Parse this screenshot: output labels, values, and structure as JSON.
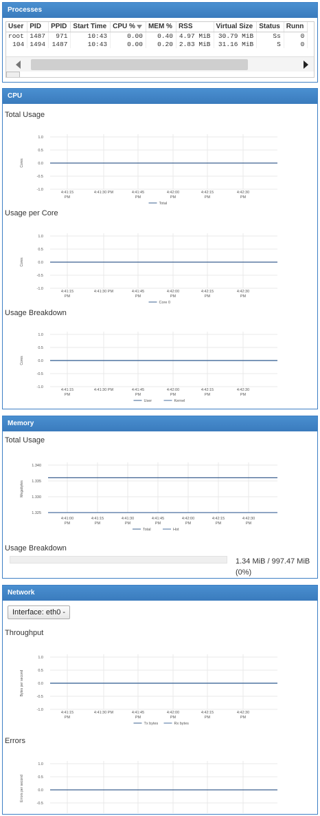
{
  "processes": {
    "title": "Processes",
    "columns": [
      "User",
      "PID",
      "PPID",
      "Start Time",
      "CPU %",
      "MEM %",
      "RSS",
      "Virtual Size",
      "Status",
      "Runn"
    ],
    "rows": [
      [
        "root",
        "1487",
        "971",
        "10:43",
        "0.00",
        "0.40",
        "4.97 MiB",
        "30.79 MiB",
        "Ss",
        "0"
      ],
      [
        "104",
        "1494",
        "1487",
        "10:43",
        "0.00",
        "0.20",
        "2.83 MiB",
        "31.16 MiB",
        "S",
        "0"
      ]
    ]
  },
  "cpu": {
    "title": "CPU",
    "total_usage": {
      "title": "Total Usage",
      "chart_data": {
        "type": "line",
        "x": [
          "4:41:15 PM",
          "4:41:30 PM",
          "4:41:45 PM",
          "4:42:00 PM",
          "4:42:15 PM",
          "4:42:30 PM"
        ],
        "xtick_lines": [
          [
            "4:41:15",
            "PM"
          ],
          [
            "4:41:30 PM"
          ],
          [
            "4:41:45",
            "PM"
          ],
          [
            "4:42:00",
            "PM"
          ],
          [
            "4:42:15",
            "PM"
          ],
          [
            "4:42:30",
            "PM"
          ]
        ],
        "yticks": [
          "1.0",
          "0.5",
          "0.0",
          "-0.5",
          "-1.0"
        ],
        "ylim": [
          -1.0,
          1.0
        ],
        "ylabel": "Cores",
        "series": [
          {
            "name": "Total",
            "values": [
              0,
              0,
              0,
              0,
              0,
              0
            ],
            "color": "#3a5f8f"
          }
        ]
      }
    },
    "usage_per_core": {
      "title": "Usage per Core",
      "chart_data": {
        "type": "line",
        "x": [
          "4:41:15 PM",
          "4:41:30 PM",
          "4:41:45 PM",
          "4:42:00 PM",
          "4:42:15 PM",
          "4:42:30 PM"
        ],
        "xtick_lines": [
          [
            "4:41:15",
            "PM"
          ],
          [
            "4:41:30 PM"
          ],
          [
            "4:41:45",
            "PM"
          ],
          [
            "4:42:00",
            "PM"
          ],
          [
            "4:42:15",
            "PM"
          ],
          [
            "4:42:30",
            "PM"
          ]
        ],
        "yticks": [
          "1.0",
          "0.5",
          "0.0",
          "-0.5",
          "-1.0"
        ],
        "ylim": [
          -1.0,
          1.0
        ],
        "ylabel": "Cores",
        "series": [
          {
            "name": "Core 0",
            "values": [
              0,
              0,
              0,
              0,
              0,
              0
            ],
            "color": "#3a5f8f"
          }
        ]
      }
    },
    "usage_breakdown": {
      "title": "Usage Breakdown",
      "chart_data": {
        "type": "line",
        "x": [
          "4:41:15 PM",
          "4:41:30 PM",
          "4:41:45 PM",
          "4:42:00 PM",
          "4:42:15 PM",
          "4:42:30 PM"
        ],
        "xtick_lines": [
          [
            "4:41:15",
            "PM"
          ],
          [
            "4:41:30 PM"
          ],
          [
            "4:41:45",
            "PM"
          ],
          [
            "4:42:00",
            "PM"
          ],
          [
            "4:42:15",
            "PM"
          ],
          [
            "4:42:30",
            "PM"
          ]
        ],
        "yticks": [
          "1.0",
          "0.5",
          "0.0",
          "-0.5",
          "-1.0"
        ],
        "ylim": [
          -1.0,
          1.0
        ],
        "ylabel": "Cores",
        "series": [
          {
            "name": "User",
            "values": [
              0,
              0,
              0,
              0,
              0,
              0
            ],
            "color": "#3a5f8f"
          },
          {
            "name": "Kernel",
            "values": [
              0,
              0,
              0,
              0,
              0,
              0
            ],
            "color": "#4a6f9f"
          }
        ]
      }
    }
  },
  "memory": {
    "title": "Memory",
    "total_usage": {
      "title": "Total Usage",
      "chart_data": {
        "type": "line",
        "x": [
          "4:41:00 PM",
          "4:41:15 PM",
          "4:41:30 PM",
          "4:41:45 PM",
          "4:42:00 PM",
          "4:42:15 PM",
          "4:42:30 PM"
        ],
        "xtick_lines": [
          [
            "4:41:00",
            "PM"
          ],
          [
            "4:41:15",
            "PM"
          ],
          [
            "4:41:30",
            "PM"
          ],
          [
            "4:41:45",
            "PM"
          ],
          [
            "4:42:00",
            "PM"
          ],
          [
            "4:42:15",
            "PM"
          ],
          [
            "4:42:30",
            "PM"
          ]
        ],
        "yticks": [
          "1.340",
          "1.335",
          "1.330",
          "1.325"
        ],
        "ylim": [
          1.325,
          1.34
        ],
        "ylabel": "Megabytes",
        "series": [
          {
            "name": "Total",
            "values": [
              1.336,
              1.336,
              1.336,
              1.336,
              1.336,
              1.336,
              1.336
            ],
            "color": "#3a5f8f"
          },
          {
            "name": "Hot",
            "values": [
              1.325,
              1.325,
              1.325,
              1.325,
              1.325,
              1.325,
              1.325
            ],
            "color": "#4a6f9f"
          }
        ]
      }
    },
    "usage_breakdown": {
      "title": "Usage Breakdown",
      "used_fraction": 0.0,
      "text": "1.34 MiB / 997.47 MiB (0%)"
    }
  },
  "network": {
    "title": "Network",
    "interface_label": "Interface: eth0 -",
    "throughput": {
      "title": "Throughput",
      "chart_data": {
        "type": "line",
        "x": [
          "4:41:15 PM",
          "4:41:30 PM",
          "4:41:45 PM",
          "4:42:00 PM",
          "4:42:15 PM",
          "4:42:30 PM"
        ],
        "xtick_lines": [
          [
            "4:41:15",
            "PM"
          ],
          [
            "4:41:30 PM"
          ],
          [
            "4:41:45",
            "PM"
          ],
          [
            "4:42:00",
            "PM"
          ],
          [
            "4:42:15",
            "PM"
          ],
          [
            "4:42:30",
            "PM"
          ]
        ],
        "yticks": [
          "1.0",
          "0.5",
          "0.0",
          "-0.5",
          "-1.0"
        ],
        "ylim": [
          -1.0,
          1.0
        ],
        "ylabel": "Bytes per second",
        "series": [
          {
            "name": "Tx bytes",
            "values": [
              0,
              0,
              0,
              0,
              0,
              0
            ],
            "color": "#3a5f8f"
          },
          {
            "name": "Rx bytes",
            "values": [
              0,
              0,
              0,
              0,
              0,
              0
            ],
            "color": "#4a6f9f"
          }
        ]
      }
    },
    "errors": {
      "title": "Errors",
      "chart_data": {
        "type": "line",
        "yticks": [
          "1.0",
          "0.5",
          "0.0",
          "-0.5"
        ],
        "ylim": [
          -1.0,
          1.0
        ],
        "ylabel": "Errors per second",
        "series": [
          {
            "values": [
              0,
              0,
              0,
              0,
              0,
              0
            ],
            "color": "#3a5f8f"
          }
        ]
      }
    }
  }
}
